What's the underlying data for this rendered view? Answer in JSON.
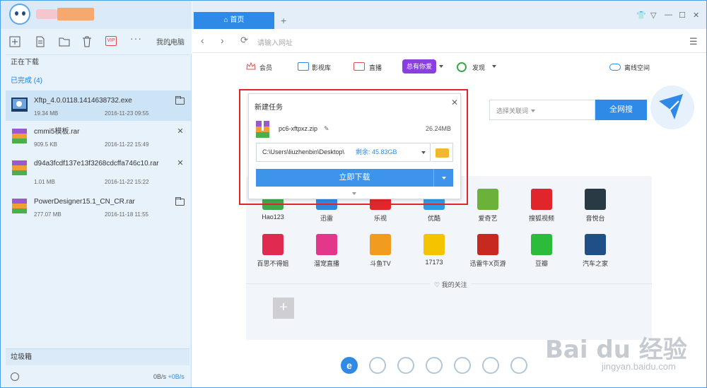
{
  "left_panel": {
    "toolbar": {
      "vip": "VIP",
      "more": "···",
      "mypc": "我的电脑"
    },
    "sections": {
      "downloading": "正在下载",
      "completed": "已完成 (4)"
    },
    "items": [
      {
        "name": "Xftp_4.0.0118.1414638732.exe",
        "size": "19.34 MB",
        "date": "2016-11-23 09:55",
        "action": "folder"
      },
      {
        "name": "cmmi5模板.rar",
        "size": "909.5 KB",
        "date": "2016-11-22 15:49",
        "action": "close"
      },
      {
        "name": "d94a3fcdf137e13f3268cdcffa746c10.rar",
        "size": "1.01 MB",
        "date": "2016-11-22 15:22",
        "action": "close"
      },
      {
        "name": "PowerDesigner15.1_CN_CR.rar",
        "size": "277.07 MB",
        "date": "2016-11-18 11:55",
        "action": "folder"
      }
    ],
    "trash": "垃圾箱",
    "speed": {
      "down": "0B/s",
      "up": "+0B/s"
    }
  },
  "browser": {
    "tab_home": "首页",
    "tab_add": "+",
    "address_placeholder": "请输入网址",
    "bookmarks": {
      "member": "会员",
      "video": "影视库",
      "live": "直播",
      "zongyou": "总有你爱",
      "discover": "发现",
      "cloud": "离线空间"
    },
    "search": {
      "dropdown": "选择关联词",
      "button": "全网搜"
    },
    "sites": [
      {
        "label": "Hao123",
        "color": "#3fa84a"
      },
      {
        "label": "迅雷",
        "color": "#2f87e0"
      },
      {
        "label": "乐视",
        "color": "#e0282a"
      },
      {
        "label": "优酷",
        "color": "#2b9be8"
      },
      {
        "label": "爱奇艺",
        "color": "#6cb23a"
      },
      {
        "label": "搜狐视频",
        "color": "#e0262b"
      },
      {
        "label": "音悦台",
        "color": "#2a3a44"
      },
      {
        "label": "百思不得姐",
        "color": "#e02a4f"
      },
      {
        "label": "溜宠直播",
        "color": "#e2378a"
      },
      {
        "label": "斗鱼TV",
        "color": "#f29c1f"
      },
      {
        "label": "17173",
        "color": "#f5c400"
      },
      {
        "label": "迅雷牛X页游",
        "color": "#c7281f"
      },
      {
        "label": "豆瓣",
        "color": "#2dbb3a"
      },
      {
        "label": "汽车之家",
        "color": "#1f4f86"
      }
    ],
    "my_follow": "♡ 我的关注",
    "add_tile": "+"
  },
  "dialog": {
    "title": "新建任务",
    "close": "✕",
    "filename": "pc6-xftpxz.zip",
    "filesize": "26.24MB",
    "path": "C:\\Users\\liuzhenbin\\Desktop\\",
    "free_space": "剩余: 45.83GB",
    "download_button": "立即下载"
  },
  "dock": {
    "active": "e"
  },
  "watermark": {
    "text1": "Bai du 经验",
    "text2": "jingyan.baidu.com"
  }
}
